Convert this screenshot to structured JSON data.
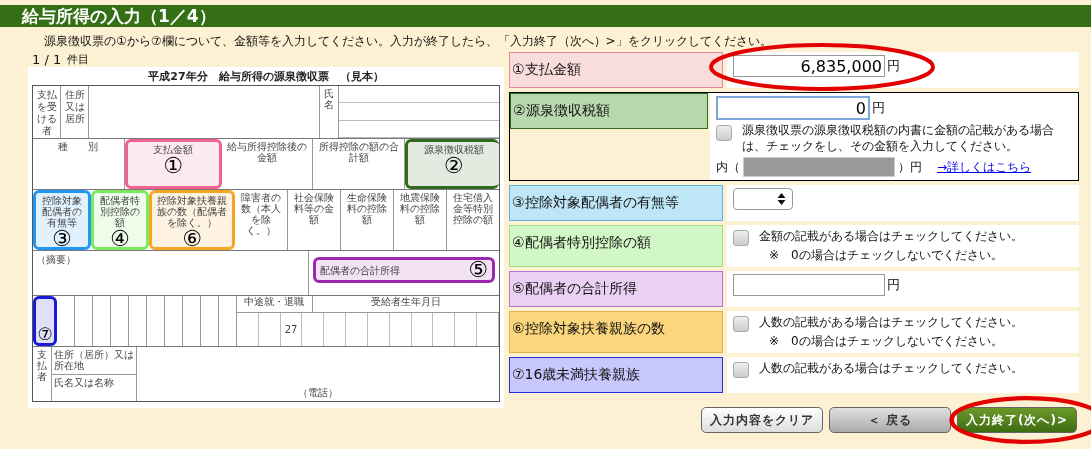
{
  "header": {
    "title": "給与所得の入力（1／4）"
  },
  "instruction": "源泉徴収票の①から⑦欄について、金額等を入力してください。入力が終了したら、「入力終了（次へ）>」をクリックしてください。",
  "counter": {
    "position": "1 / 1",
    "unit": "件目"
  },
  "form": {
    "title": "平成27年分　給与所得の源泉徴収票　（見本）",
    "recipient_label": "支払を受ける者",
    "address_label": "住所又は居所",
    "name_label": "氏名",
    "amount_headers": [
      {
        "label": "種　　別"
      },
      {
        "label": "支払金額",
        "marker": "①",
        "color": "#f06292"
      },
      {
        "label": "給与所得控除後の金額"
      },
      {
        "label": "所得控除の額の合計額"
      },
      {
        "label": "源泉徴収税額",
        "marker": "②",
        "color": "#2e6b1e"
      }
    ],
    "deduction_headers": [
      {
        "label": "控除対象配偶者の有無等",
        "marker": "③",
        "color": "#2196f3"
      },
      {
        "label": "配偶者特別控除の額",
        "marker": "④",
        "color": "#7ee85e"
      },
      {
        "label": "控除対象扶養親族の数（配偶者を除く。）",
        "marker": "⑥",
        "color": "#f5a623"
      },
      {
        "label": "障害者の数（本人を除く。）"
      },
      {
        "label": "社会保険料等の金額"
      },
      {
        "label": "生命保険料の控除額"
      },
      {
        "label": "地震保険料の控除額"
      },
      {
        "label": "住宅借入金等特別控除の額"
      }
    ],
    "remarks_label": "（摘要）",
    "spouse_income": {
      "label": "配偶者の合計所得",
      "marker": "⑤",
      "color": "#9c27b0"
    },
    "dependents_under16": {
      "marker": "⑦",
      "color": "#1a1ad6"
    },
    "retire_header": "中途就・退職",
    "birth_header": "受給者生年月日",
    "year": "27",
    "payer_label": "支払者",
    "payer_address_label": "住所（居所）又は所在地",
    "payer_name_label": "氏名又は名称",
    "phone_label": "（電話）"
  },
  "fields": [
    {
      "kind": "amount",
      "label": "①支払金額",
      "color": "#f9dcdc",
      "value": "6,835,000",
      "unit": "円",
      "highlighted": true
    },
    {
      "kind": "breakdown",
      "label": "②源泉徴収税額",
      "color": "#b8d8b0",
      "value": "0",
      "unit": "円",
      "check_text": "源泉徴収票の源泉徴収税額の内書に金額の記載がある場合は、チェックをし、その金額を入力してください。",
      "checked": false,
      "breakdown_prefix": "内（",
      "breakdown_suffix": "）円",
      "breakdown_disabled": true,
      "link": "→詳しくはこちら"
    },
    {
      "kind": "select",
      "label": "③控除対象配偶者の有無等",
      "color": "#bfe6f6"
    },
    {
      "kind": "check",
      "label": "④配偶者特別控除の額",
      "color": "#d2f7c6",
      "check_text": "金額の記載がある場合はチェックしてください。",
      "note": "※　0の場合はチェックしないでください。",
      "checked": false
    },
    {
      "kind": "amount",
      "label": "⑤配偶者の合計所得",
      "color": "#ead0f3",
      "unit": "円"
    },
    {
      "kind": "check",
      "label": "⑥控除対象扶養親族の数",
      "color": "#fbd67c",
      "check_text": "人数の記載がある場合はチェックしてください。",
      "note": "※　0の場合はチェックしないでください。",
      "checked": false
    },
    {
      "kind": "check",
      "label": "⑦16歳未満扶養親族",
      "color": "#c8c8ff",
      "check_text": "人数の記載がある場合はチェックしてください。",
      "checked": false
    }
  ],
  "buttons": [
    {
      "kind": "clear",
      "label": "入力内容をクリア"
    },
    {
      "kind": "back",
      "label": "＜ 戻る"
    },
    {
      "kind": "next",
      "label": "入力終了(次へ)>",
      "highlighted": true
    }
  ]
}
